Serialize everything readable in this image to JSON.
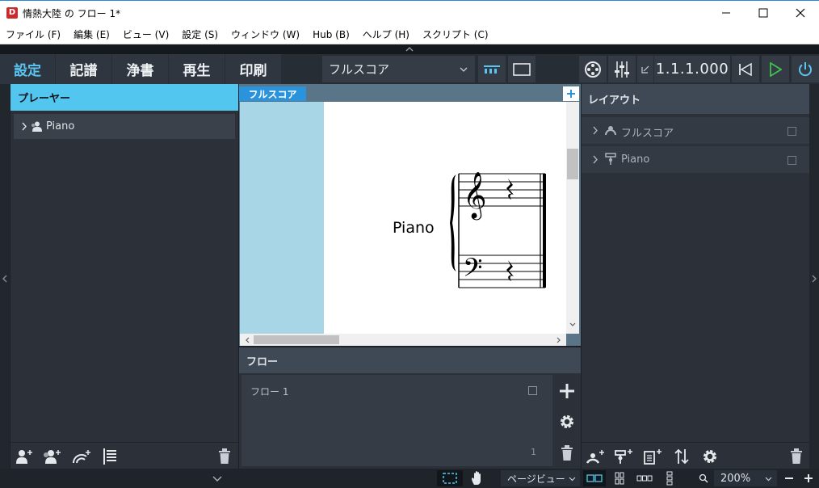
{
  "window": {
    "title": "情熱大陸 の フロー 1*",
    "app_icon": "D"
  },
  "menu": [
    {
      "label": "ファイル (F)"
    },
    {
      "label": "編集 (E)"
    },
    {
      "label": "ビュー (V)"
    },
    {
      "label": "設定 (S)"
    },
    {
      "label": "ウィンドウ (W)"
    },
    {
      "label": "Hub (B)"
    },
    {
      "label": "ヘルプ (H)"
    },
    {
      "label": "スクリプト (C)"
    }
  ],
  "modes": [
    {
      "label": "設定",
      "active": true
    },
    {
      "label": "記譜",
      "active": false
    },
    {
      "label": "浄書",
      "active": false
    },
    {
      "label": "再生",
      "active": false
    },
    {
      "label": "印刷",
      "active": false
    }
  ],
  "layout_select": {
    "value": "フルスコア"
  },
  "transport": {
    "position": "1.1.1.000"
  },
  "players_panel": {
    "title": "プレーヤー",
    "items": [
      {
        "label": "Piano"
      }
    ]
  },
  "score": {
    "tab": "フルスコア",
    "instrument_label": "Piano"
  },
  "flows_panel": {
    "title": "フロー",
    "items": [
      {
        "label": "フロー 1"
      }
    ],
    "number": "1"
  },
  "layouts_panel": {
    "title": "レイアウト",
    "items": [
      {
        "label": "フルスコア"
      },
      {
        "label": "Piano"
      }
    ]
  },
  "statusbar": {
    "view_mode": "ページビュー",
    "zoom": "200%"
  },
  "colors": {
    "accent": "#5bc5f1",
    "play": "#3ec14d",
    "title_bar_fill": "#53c6f0"
  }
}
